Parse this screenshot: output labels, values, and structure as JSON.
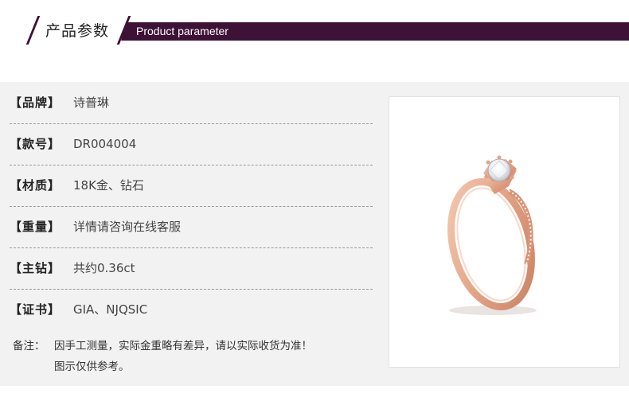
{
  "header": {
    "title_cn": "产品参数",
    "title_en": "Product parameter"
  },
  "params": [
    {
      "label": "【品牌】",
      "value": "诗普琳"
    },
    {
      "label": "【款号】",
      "value": "DR004004"
    },
    {
      "label": "【材质】",
      "value": "18K金、钻石"
    },
    {
      "label": "【重量】",
      "value": "详情请咨询在线客服"
    },
    {
      "label": "【主钻】",
      "value": "共约0.36ct"
    },
    {
      "label": "【证书】",
      "value": "GIA、NJQSIC"
    }
  ],
  "note": {
    "label": "备注：",
    "line1": "因手工测量，实际金重略有差异，请以实际收货为准！",
    "line2": "图示仅供参考。"
  },
  "colors": {
    "banner": "#3e1136",
    "panel_bg": "#f2f2f3",
    "rose_gold": "#e8a98a"
  },
  "product_image": "rose-gold-diamond-ring"
}
